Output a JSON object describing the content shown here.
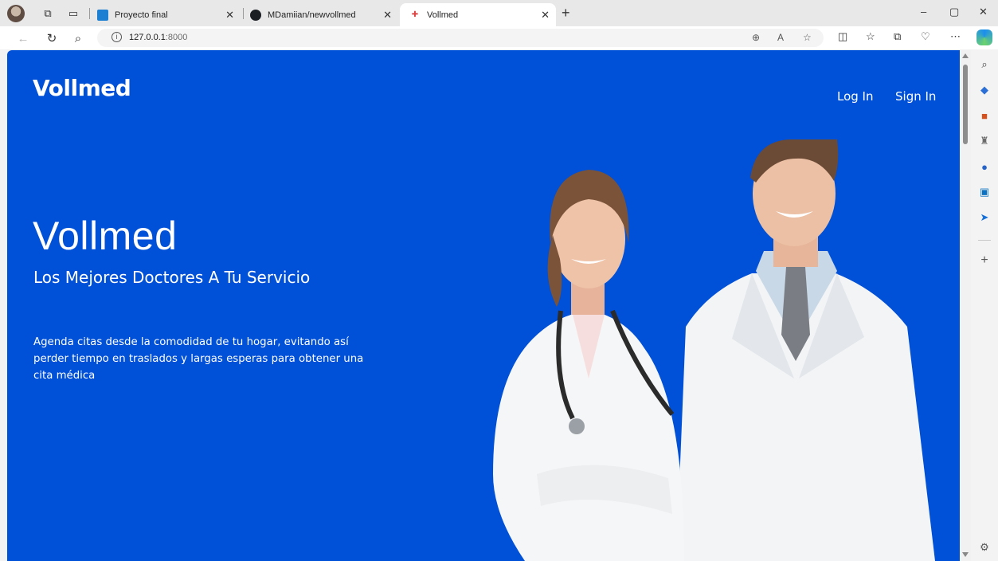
{
  "browser": {
    "tabs": [
      {
        "title": "Proyecto final",
        "active": false
      },
      {
        "title": "MDamiian/newvollmed",
        "active": false
      },
      {
        "title": "Vollmed",
        "active": true
      }
    ],
    "new_tab": "+",
    "address": {
      "host": "127.0.0.1",
      "port": ":8000"
    },
    "window_controls": {
      "minimize": "–",
      "restore": "▢",
      "close": "✕"
    }
  },
  "site": {
    "brand": "Vollmed",
    "nav": {
      "login": "Log In",
      "signin": "Sign In"
    },
    "hero": {
      "title": "Vollmed",
      "subtitle": "Los Mejores Doctores A Tu Servicio",
      "description": "Agenda citas desde la comodidad de tu hogar, evitando así perder tiempo en traslados y largas esperas para obtener una cita médica"
    }
  },
  "colors": {
    "hero_background": "#0050d8",
    "text": "#ffffff"
  },
  "sidebar_icons": [
    "search-icon",
    "tag-icon",
    "briefcase-icon",
    "games-icon",
    "office-icon",
    "outlook-icon",
    "send-icon",
    "add-icon",
    "settings-icon"
  ]
}
